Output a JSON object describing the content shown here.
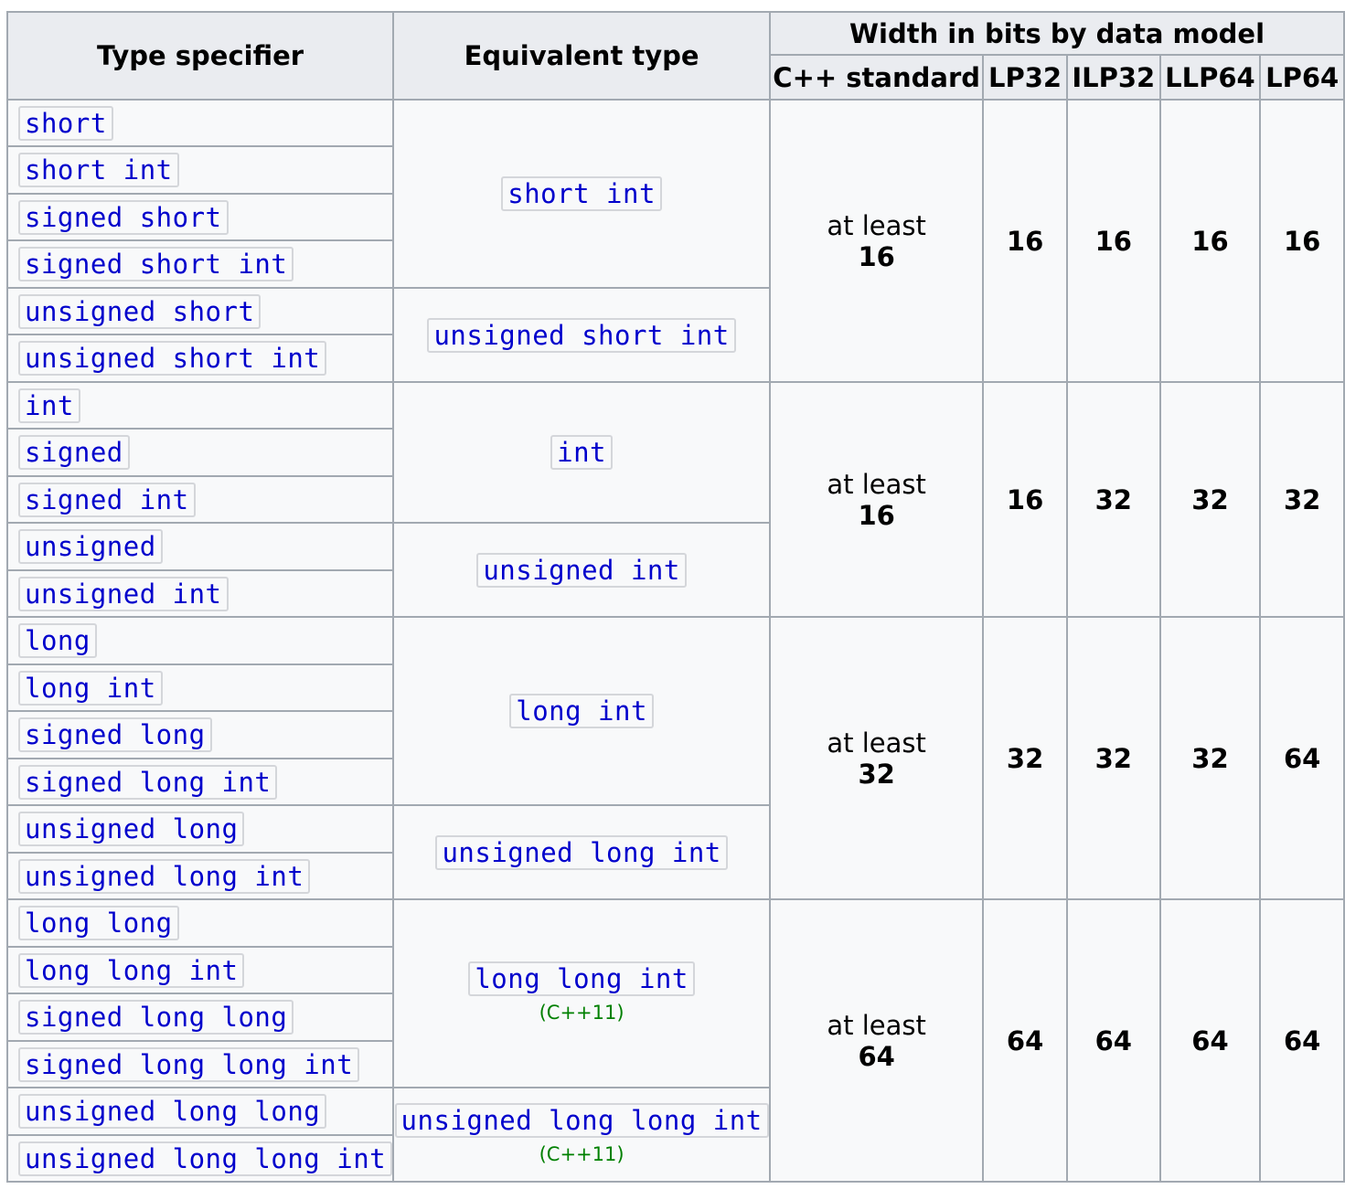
{
  "headers": {
    "type_specifier": "Type specifier",
    "equivalent_type": "Equivalent type",
    "width_group": "Width in bits by data model",
    "cpp_standard": "C++ standard",
    "lp32": "LP32",
    "ilp32": "ILP32",
    "llp64": "LLP64",
    "lp64": "LP64"
  },
  "specifiers": [
    "short",
    "short int",
    "signed short",
    "signed short int",
    "unsigned short",
    "unsigned short int",
    "int",
    "signed",
    "signed int",
    "unsigned",
    "unsigned int",
    "long",
    "long int",
    "signed long",
    "signed long int",
    "unsigned long",
    "unsigned long int",
    "long long",
    "long long int",
    "signed long long",
    "signed long long int",
    "unsigned long long",
    "unsigned long long int"
  ],
  "equivalents": [
    {
      "type": "short int",
      "note": ""
    },
    {
      "type": "unsigned short int",
      "note": ""
    },
    {
      "type": "int",
      "note": ""
    },
    {
      "type": "unsigned int",
      "note": ""
    },
    {
      "type": "long int",
      "note": ""
    },
    {
      "type": "unsigned long int",
      "note": ""
    },
    {
      "type": "long long int",
      "note": "(C++11)"
    },
    {
      "type": "unsigned long long int",
      "note": "(C++11)"
    }
  ],
  "widths": [
    {
      "at_least": "at least",
      "standard": "16",
      "lp32": "16",
      "ilp32": "16",
      "llp64": "16",
      "lp64": "16"
    },
    {
      "at_least": "at least",
      "standard": "16",
      "lp32": "16",
      "ilp32": "32",
      "llp64": "32",
      "lp64": "32"
    },
    {
      "at_least": "at least",
      "standard": "32",
      "lp32": "32",
      "ilp32": "32",
      "llp64": "32",
      "lp64": "64"
    },
    {
      "at_least": "at least",
      "standard": "64",
      "lp32": "64",
      "ilp32": "64",
      "llp64": "64",
      "lp64": "64"
    }
  ]
}
